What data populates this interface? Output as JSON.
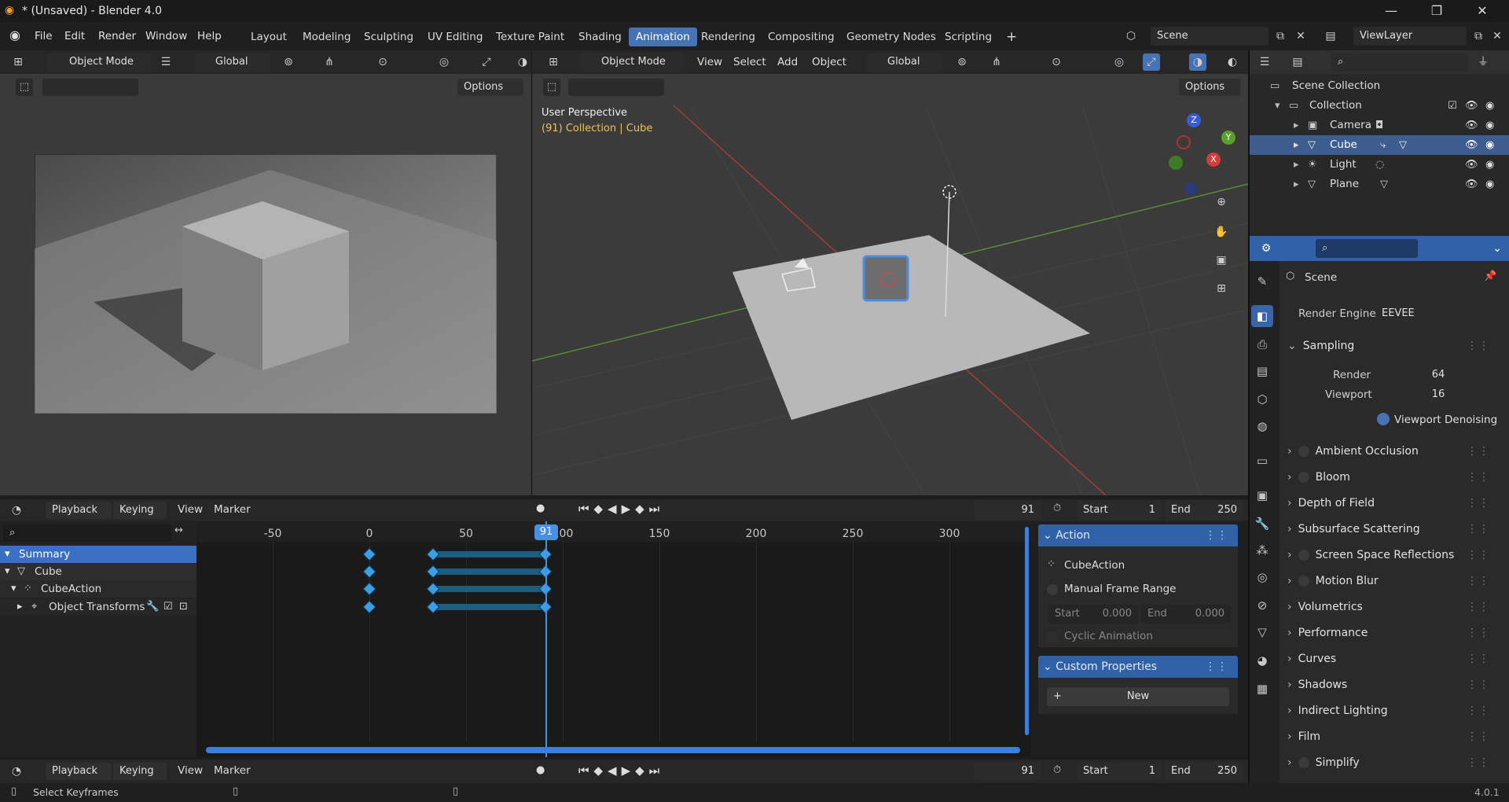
{
  "window": {
    "title": "* (Unsaved) - Blender 4.0",
    "minimize": "—",
    "maximize": "❐",
    "close": "✕"
  },
  "menu": [
    "File",
    "Edit",
    "Render",
    "Window",
    "Help"
  ],
  "workspaces": [
    "Layout",
    "Modeling",
    "Sculpting",
    "UV Editing",
    "Texture Paint",
    "Shading",
    "Animation",
    "Rendering",
    "Compositing",
    "Geometry Nodes",
    "Scripting"
  ],
  "workspace_add": "+",
  "scene_name": "Scene",
  "view_layer": "ViewLayer",
  "left_view": {
    "mode": "Object Mode",
    "orientation": "Global",
    "options": "Options"
  },
  "main_view": {
    "mode": "Object Mode",
    "menus": [
      "View",
      "Select",
      "Add",
      "Object"
    ],
    "orientation": "Global",
    "options": "Options",
    "overlay_title": "User Perspective",
    "overlay_sub": "(91) Collection | Cube"
  },
  "gizmo": {
    "z": "Z",
    "y": "Y",
    "x": "X"
  },
  "outliner": {
    "root": "Scene Collection",
    "collection": "Collection",
    "items": [
      "Camera",
      "Cube",
      "Light",
      "Plane"
    ],
    "selected": "Cube"
  },
  "properties": {
    "scene": "Scene",
    "render_engine_label": "Render Engine",
    "render_engine": "EEVEE",
    "sampling": "Sampling",
    "render_label": "Render",
    "render_value": "64",
    "viewport_label": "Viewport",
    "viewport_value": "16",
    "viewport_denoising": "Viewport Denoising",
    "panels": [
      "Ambient Occlusion",
      "Bloom",
      "Depth of Field",
      "Subsurface Scattering",
      "Screen Space Reflections",
      "Motion Blur",
      "Volumetrics",
      "Performance",
      "Curves",
      "Shadows",
      "Indirect Lighting",
      "Film",
      "Simplify"
    ],
    "panels_with_checkbox": [
      "Ambient Occlusion",
      "Bloom",
      "Screen Space Reflections",
      "Motion Blur",
      "Simplify"
    ]
  },
  "timeline": {
    "menus": [
      "Playback",
      "Keying",
      "View",
      "Marker"
    ],
    "current_frame": "91",
    "start_label": "Start",
    "start": "1",
    "end_label": "End",
    "end": "250",
    "ticks": [
      "-50",
      "0",
      "50",
      "100",
      "150",
      "200",
      "250",
      "300"
    ],
    "playhead_label": "91"
  },
  "dopesheet": {
    "channels": [
      "Summary",
      "Cube",
      "CubeAction",
      "Object Transforms"
    ],
    "keyframes": [
      0,
      33,
      91
    ]
  },
  "action_panel": {
    "header": "Action",
    "action_name": "CubeAction",
    "manual_range": "Manual Frame Range",
    "start_label": "Start",
    "start": "0.000",
    "end_label": "End",
    "end": "0.000",
    "cyclic": "Cyclic Animation",
    "custom_props": "Custom Properties",
    "new_button": "New"
  },
  "status": {
    "hint": "Select Keyframes",
    "version": "4.0.1"
  },
  "colors": {
    "accent": "#4772b3",
    "keyframe": "#3aa0e6",
    "playhead": "#4a90e2",
    "selected_row": "#3d5d8f"
  }
}
